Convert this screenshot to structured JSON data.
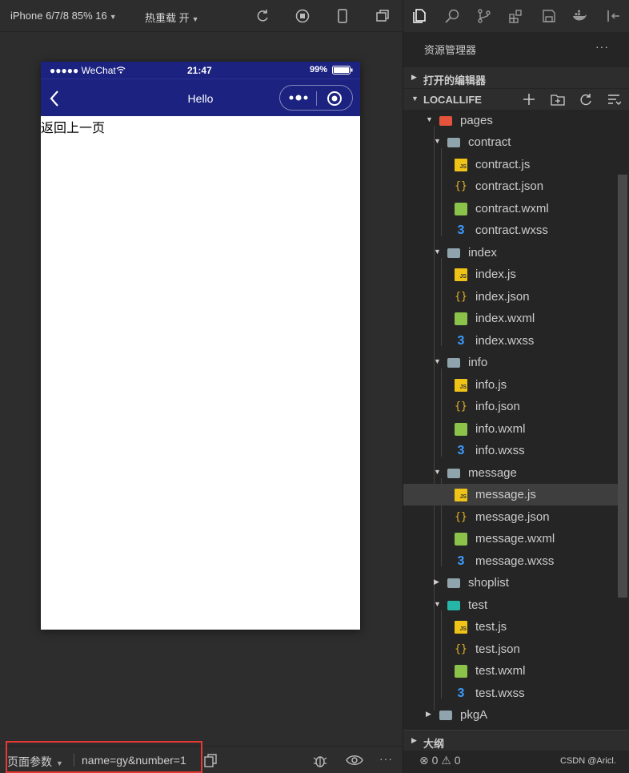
{
  "simulator": {
    "toolbar": {
      "device": "iPhone 6/7/8 85% 16",
      "hot_reload": "热重载 开",
      "icons": [
        "refresh-icon",
        "stop-icon",
        "phone-icon",
        "window-icon"
      ]
    },
    "status_bar": {
      "signal": "●●●●● WeChat",
      "time": "21:47",
      "battery": "99%"
    },
    "nav_bar": {
      "title": "Hello",
      "back_icon": "chevron-left-icon",
      "capsule_icons": [
        "more-dots-icon",
        "close-circle-icon"
      ]
    },
    "page": {
      "link_text": "返回上一页"
    },
    "bottom_bar": {
      "params_label": "页面参数",
      "params_value": "name=gy&number=1",
      "icons": [
        "copy-icon",
        "bug-icon",
        "eye-icon",
        "more-icon"
      ]
    }
  },
  "explorer": {
    "activity_icons": [
      "files-icon",
      "search-icon",
      "source-control-icon",
      "extensions-icon",
      "save-icon",
      "docker-icon",
      "collapse-icon"
    ],
    "title": "资源管理器",
    "more": "···",
    "open_editors": "打开的编辑器",
    "project": "LOCALLIFE",
    "outline": "大纲",
    "status": {
      "errors": "⊗ 0 ⚠ 0",
      "watermark": "CSDN @Aricl."
    },
    "tree": [
      {
        "name": "pages",
        "type": "folder-red",
        "expanded": true,
        "depth": 0
      },
      {
        "name": "contract",
        "type": "folder",
        "expanded": true,
        "depth": 1
      },
      {
        "name": "contract.js",
        "type": "js",
        "depth": 2
      },
      {
        "name": "contract.json",
        "type": "json",
        "depth": 2
      },
      {
        "name": "contract.wxml",
        "type": "wxml",
        "depth": 2
      },
      {
        "name": "contract.wxss",
        "type": "wxss",
        "depth": 2
      },
      {
        "name": "index",
        "type": "folder",
        "expanded": true,
        "depth": 1
      },
      {
        "name": "index.js",
        "type": "js",
        "depth": 2
      },
      {
        "name": "index.json",
        "type": "json",
        "depth": 2
      },
      {
        "name": "index.wxml",
        "type": "wxml",
        "depth": 2
      },
      {
        "name": "index.wxss",
        "type": "wxss",
        "depth": 2
      },
      {
        "name": "info",
        "type": "folder",
        "expanded": true,
        "depth": 1
      },
      {
        "name": "info.js",
        "type": "js",
        "depth": 2
      },
      {
        "name": "info.json",
        "type": "json",
        "depth": 2
      },
      {
        "name": "info.wxml",
        "type": "wxml",
        "depth": 2
      },
      {
        "name": "info.wxss",
        "type": "wxss",
        "depth": 2
      },
      {
        "name": "message",
        "type": "folder",
        "expanded": true,
        "depth": 1
      },
      {
        "name": "message.js",
        "type": "js",
        "depth": 2,
        "selected": true
      },
      {
        "name": "message.json",
        "type": "json",
        "depth": 2
      },
      {
        "name": "message.wxml",
        "type": "wxml",
        "depth": 2
      },
      {
        "name": "message.wxss",
        "type": "wxss",
        "depth": 2
      },
      {
        "name": "shoplist",
        "type": "folder",
        "expanded": false,
        "depth": 1
      },
      {
        "name": "test",
        "type": "folder-teal",
        "expanded": true,
        "depth": 1
      },
      {
        "name": "test.js",
        "type": "js",
        "depth": 2
      },
      {
        "name": "test.json",
        "type": "json",
        "depth": 2
      },
      {
        "name": "test.wxml",
        "type": "wxml",
        "depth": 2
      },
      {
        "name": "test.wxss",
        "type": "wxss",
        "depth": 2
      },
      {
        "name": "pkgA",
        "type": "folder",
        "expanded": false,
        "depth": 0
      }
    ]
  }
}
